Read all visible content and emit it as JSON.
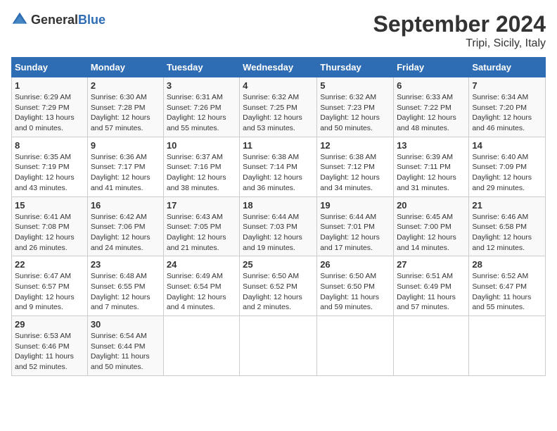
{
  "logo": {
    "text_general": "General",
    "text_blue": "Blue"
  },
  "title": "September 2024",
  "subtitle": "Tripi, Sicily, Italy",
  "days_of_week": [
    "Sunday",
    "Monday",
    "Tuesday",
    "Wednesday",
    "Thursday",
    "Friday",
    "Saturday"
  ],
  "weeks": [
    [
      {
        "day": "1",
        "info": "Sunrise: 6:29 AM\nSunset: 7:29 PM\nDaylight: 13 hours\nand 0 minutes."
      },
      {
        "day": "2",
        "info": "Sunrise: 6:30 AM\nSunset: 7:28 PM\nDaylight: 12 hours\nand 57 minutes."
      },
      {
        "day": "3",
        "info": "Sunrise: 6:31 AM\nSunset: 7:26 PM\nDaylight: 12 hours\nand 55 minutes."
      },
      {
        "day": "4",
        "info": "Sunrise: 6:32 AM\nSunset: 7:25 PM\nDaylight: 12 hours\nand 53 minutes."
      },
      {
        "day": "5",
        "info": "Sunrise: 6:32 AM\nSunset: 7:23 PM\nDaylight: 12 hours\nand 50 minutes."
      },
      {
        "day": "6",
        "info": "Sunrise: 6:33 AM\nSunset: 7:22 PM\nDaylight: 12 hours\nand 48 minutes."
      },
      {
        "day": "7",
        "info": "Sunrise: 6:34 AM\nSunset: 7:20 PM\nDaylight: 12 hours\nand 46 minutes."
      }
    ],
    [
      {
        "day": "8",
        "info": "Sunrise: 6:35 AM\nSunset: 7:19 PM\nDaylight: 12 hours\nand 43 minutes."
      },
      {
        "day": "9",
        "info": "Sunrise: 6:36 AM\nSunset: 7:17 PM\nDaylight: 12 hours\nand 41 minutes."
      },
      {
        "day": "10",
        "info": "Sunrise: 6:37 AM\nSunset: 7:16 PM\nDaylight: 12 hours\nand 38 minutes."
      },
      {
        "day": "11",
        "info": "Sunrise: 6:38 AM\nSunset: 7:14 PM\nDaylight: 12 hours\nand 36 minutes."
      },
      {
        "day": "12",
        "info": "Sunrise: 6:38 AM\nSunset: 7:12 PM\nDaylight: 12 hours\nand 34 minutes."
      },
      {
        "day": "13",
        "info": "Sunrise: 6:39 AM\nSunset: 7:11 PM\nDaylight: 12 hours\nand 31 minutes."
      },
      {
        "day": "14",
        "info": "Sunrise: 6:40 AM\nSunset: 7:09 PM\nDaylight: 12 hours\nand 29 minutes."
      }
    ],
    [
      {
        "day": "15",
        "info": "Sunrise: 6:41 AM\nSunset: 7:08 PM\nDaylight: 12 hours\nand 26 minutes."
      },
      {
        "day": "16",
        "info": "Sunrise: 6:42 AM\nSunset: 7:06 PM\nDaylight: 12 hours\nand 24 minutes."
      },
      {
        "day": "17",
        "info": "Sunrise: 6:43 AM\nSunset: 7:05 PM\nDaylight: 12 hours\nand 21 minutes."
      },
      {
        "day": "18",
        "info": "Sunrise: 6:44 AM\nSunset: 7:03 PM\nDaylight: 12 hours\nand 19 minutes."
      },
      {
        "day": "19",
        "info": "Sunrise: 6:44 AM\nSunset: 7:01 PM\nDaylight: 12 hours\nand 17 minutes."
      },
      {
        "day": "20",
        "info": "Sunrise: 6:45 AM\nSunset: 7:00 PM\nDaylight: 12 hours\nand 14 minutes."
      },
      {
        "day": "21",
        "info": "Sunrise: 6:46 AM\nSunset: 6:58 PM\nDaylight: 12 hours\nand 12 minutes."
      }
    ],
    [
      {
        "day": "22",
        "info": "Sunrise: 6:47 AM\nSunset: 6:57 PM\nDaylight: 12 hours\nand 9 minutes."
      },
      {
        "day": "23",
        "info": "Sunrise: 6:48 AM\nSunset: 6:55 PM\nDaylight: 12 hours\nand 7 minutes."
      },
      {
        "day": "24",
        "info": "Sunrise: 6:49 AM\nSunset: 6:54 PM\nDaylight: 12 hours\nand 4 minutes."
      },
      {
        "day": "25",
        "info": "Sunrise: 6:50 AM\nSunset: 6:52 PM\nDaylight: 12 hours\nand 2 minutes."
      },
      {
        "day": "26",
        "info": "Sunrise: 6:50 AM\nSunset: 6:50 PM\nDaylight: 11 hours\nand 59 minutes."
      },
      {
        "day": "27",
        "info": "Sunrise: 6:51 AM\nSunset: 6:49 PM\nDaylight: 11 hours\nand 57 minutes."
      },
      {
        "day": "28",
        "info": "Sunrise: 6:52 AM\nSunset: 6:47 PM\nDaylight: 11 hours\nand 55 minutes."
      }
    ],
    [
      {
        "day": "29",
        "info": "Sunrise: 6:53 AM\nSunset: 6:46 PM\nDaylight: 11 hours\nand 52 minutes."
      },
      {
        "day": "30",
        "info": "Sunrise: 6:54 AM\nSunset: 6:44 PM\nDaylight: 11 hours\nand 50 minutes."
      },
      {
        "day": "",
        "info": ""
      },
      {
        "day": "",
        "info": ""
      },
      {
        "day": "",
        "info": ""
      },
      {
        "day": "",
        "info": ""
      },
      {
        "day": "",
        "info": ""
      }
    ]
  ]
}
